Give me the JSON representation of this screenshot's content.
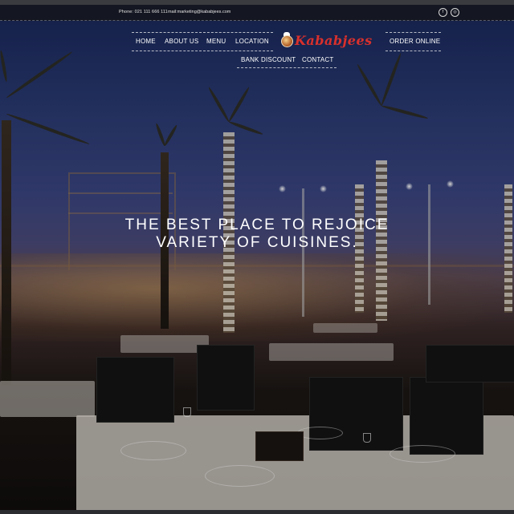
{
  "topbar": {
    "phone": "Phone: 021 111 666 111",
    "email": "mail:marketing@kababjees.com",
    "social": [
      {
        "icon": "facebook-icon",
        "glyph": "f"
      },
      {
        "icon": "instagram-icon",
        "glyph": "◎"
      }
    ]
  },
  "nav": {
    "home": "HOME",
    "about": "ABOUT US",
    "menu": "MENU",
    "location": "LOCATION",
    "order_online": "ORDER ONLINE",
    "bank_discount": "BANK DISCOUNT",
    "contact": "CONTACT"
  },
  "brand": {
    "logo_text": "Kababjees",
    "logo_color": "#d9302c"
  },
  "hero": {
    "headline_line1": "THE BEST PLACE TO REJOICE",
    "headline_line2": "VARIETY OF CUISINES."
  },
  "colors": {
    "topbar_bg": "#141621",
    "sky_top": "#1b2a5c",
    "text": "#ffffff"
  }
}
